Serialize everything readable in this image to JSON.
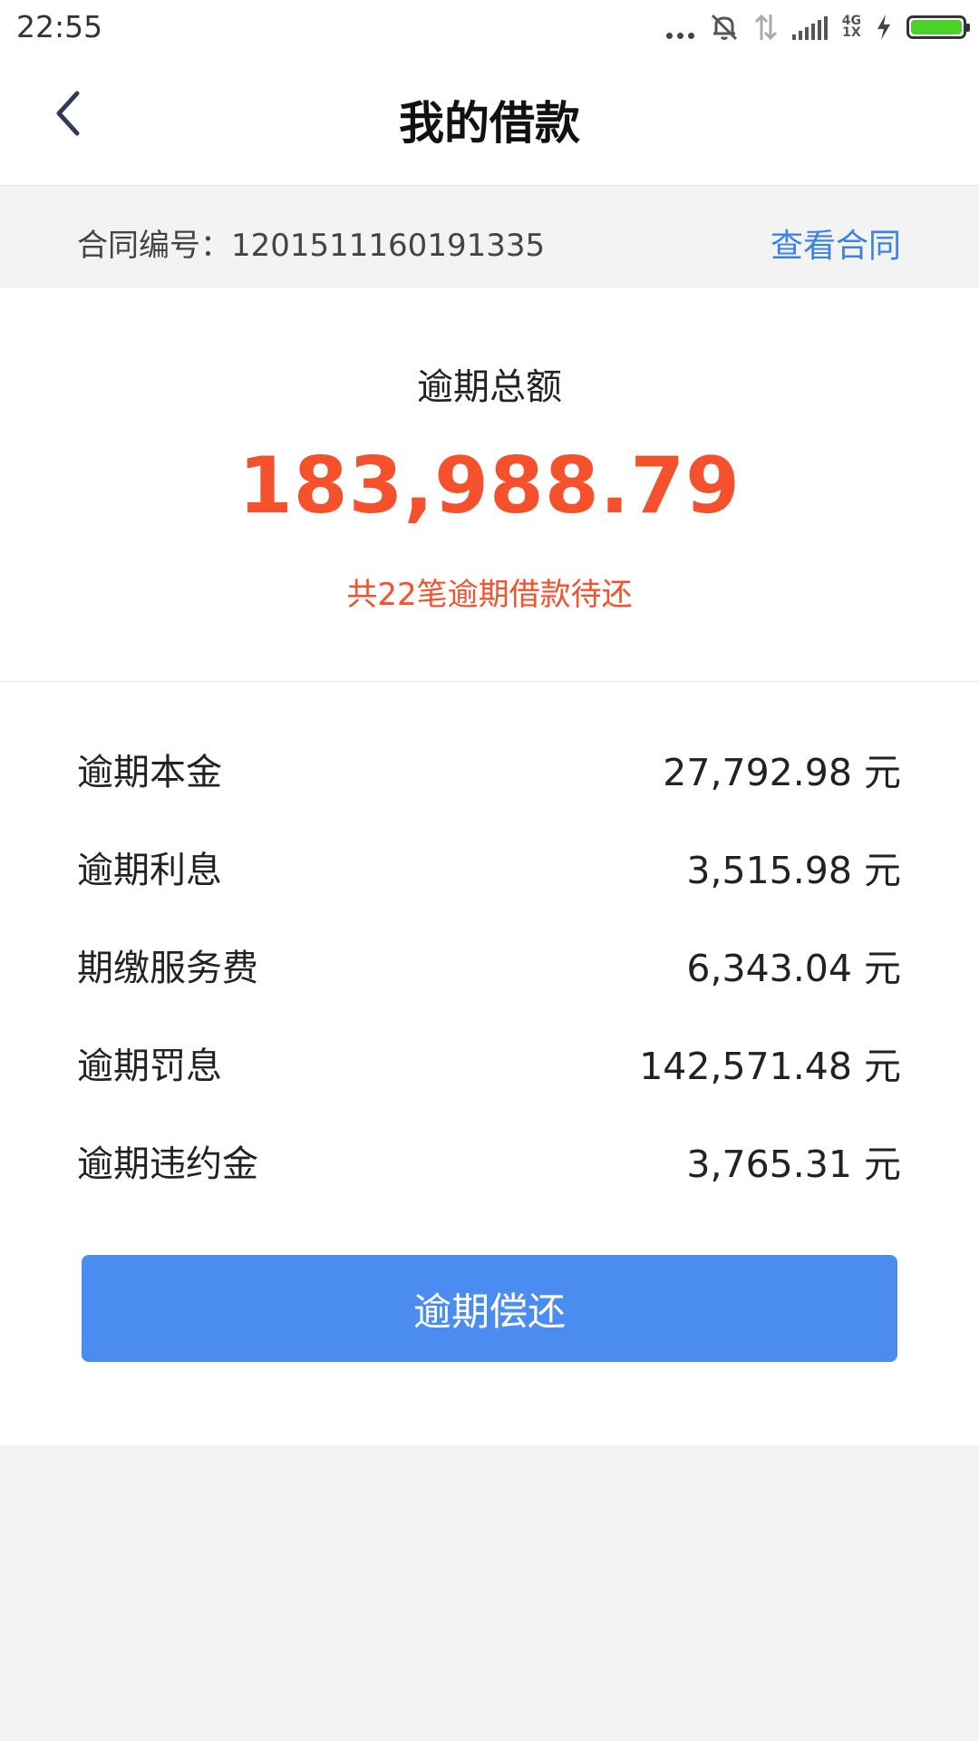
{
  "status_bar": {
    "time": "22:55",
    "network_top": "4G",
    "network_bottom": "1X",
    "battery_level_percent": 100
  },
  "nav": {
    "title": "我的借款",
    "back_icon": "chevron-left-icon"
  },
  "contract": {
    "label": "合同编号：1201511160191335",
    "link": "查看合同"
  },
  "summary": {
    "title": "逾期总额",
    "amount": "183,988.79",
    "note": "共22笔逾期借款待还"
  },
  "details": [
    {
      "label": "逾期本金",
      "value": "27,792.98 元"
    },
    {
      "label": "逾期利息",
      "value": "3,515.98 元"
    },
    {
      "label": "期缴服务费",
      "value": "6,343.04 元"
    },
    {
      "label": "逾期罚息",
      "value": "142,571.48 元"
    },
    {
      "label": "逾期违约金",
      "value": "3,765.31 元"
    }
  ],
  "actions": {
    "repay_label": "逾期偿还"
  },
  "colors": {
    "accent_blue": "#4a8cf0",
    "link_blue": "#3b82e6",
    "alert_red": "#f4512c"
  }
}
